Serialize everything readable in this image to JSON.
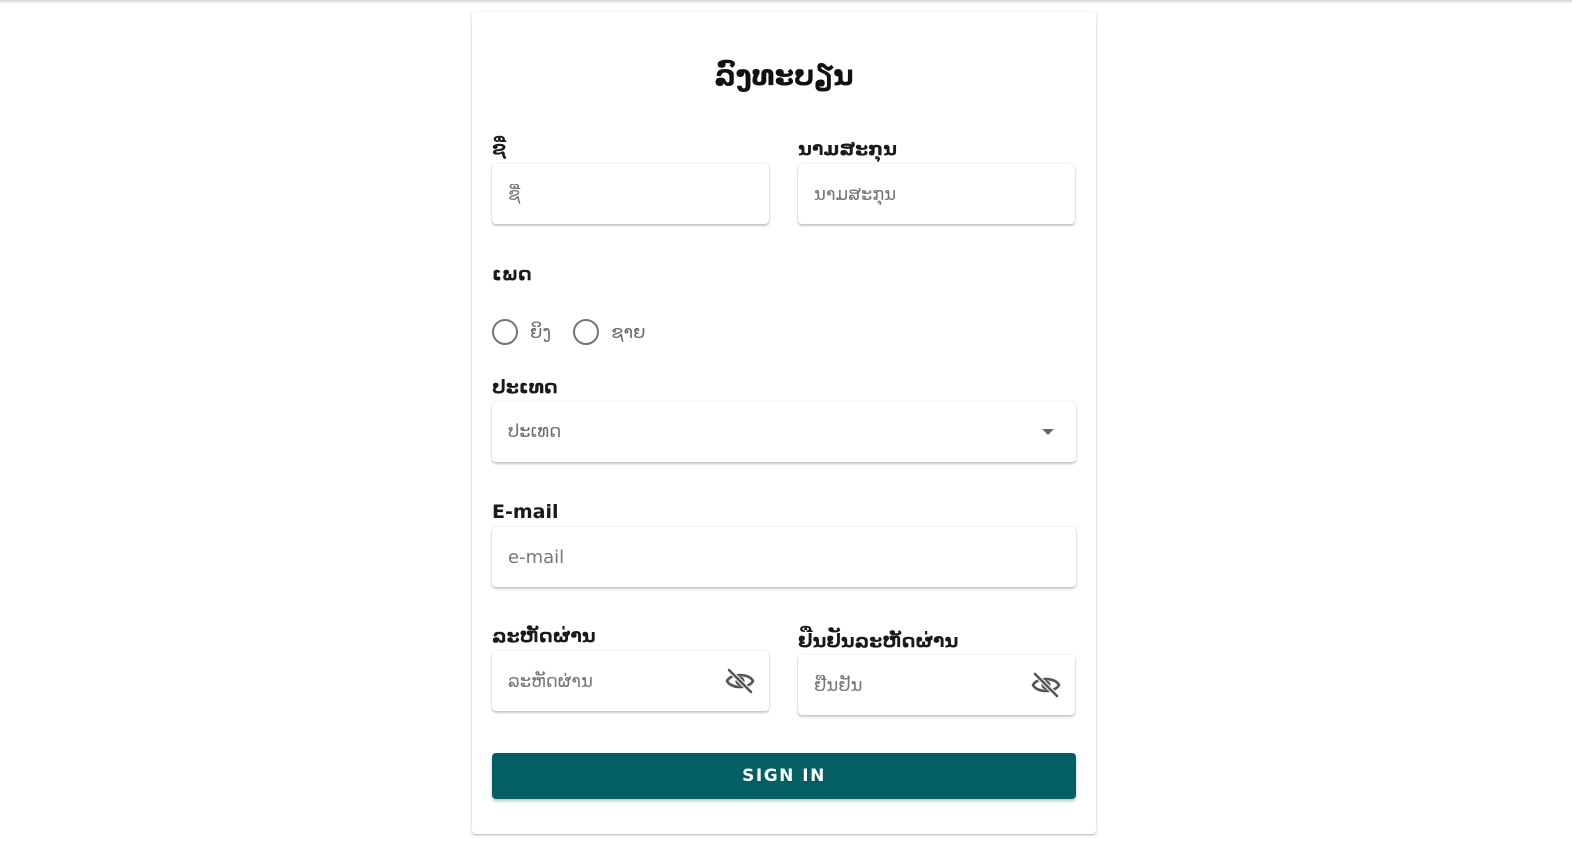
{
  "form": {
    "title": "ລົງທະບຽນ",
    "first_name": {
      "label": "ຊື່",
      "placeholder": "ຊື່",
      "value": ""
    },
    "last_name": {
      "label": "ນາມສະກຸນ",
      "placeholder": "ນາມສະກຸນ",
      "value": ""
    },
    "gender": {
      "label": "ເພດ",
      "options": [
        "ຍິງ",
        "ຊາຍ"
      ],
      "selected": null
    },
    "country": {
      "label": "ປະເທດ",
      "placeholder": "ປະເທດ"
    },
    "email": {
      "label": "E-mail",
      "placeholder": "e-mail",
      "value": ""
    },
    "password": {
      "label": "ລະຫັດຜ່ານ",
      "placeholder": "ລະຫັດຜ່ານ",
      "icon": "eye-off-icon"
    },
    "confirm_password": {
      "label": "ຢືນຢັນລະຫັດຜ່ານ",
      "placeholder": "ຢືນຢັນ",
      "icon": "eye-off-icon"
    },
    "submit_label": "SIGN IN"
  },
  "colors": {
    "primary": "#035f63",
    "background": "#ffffff"
  }
}
